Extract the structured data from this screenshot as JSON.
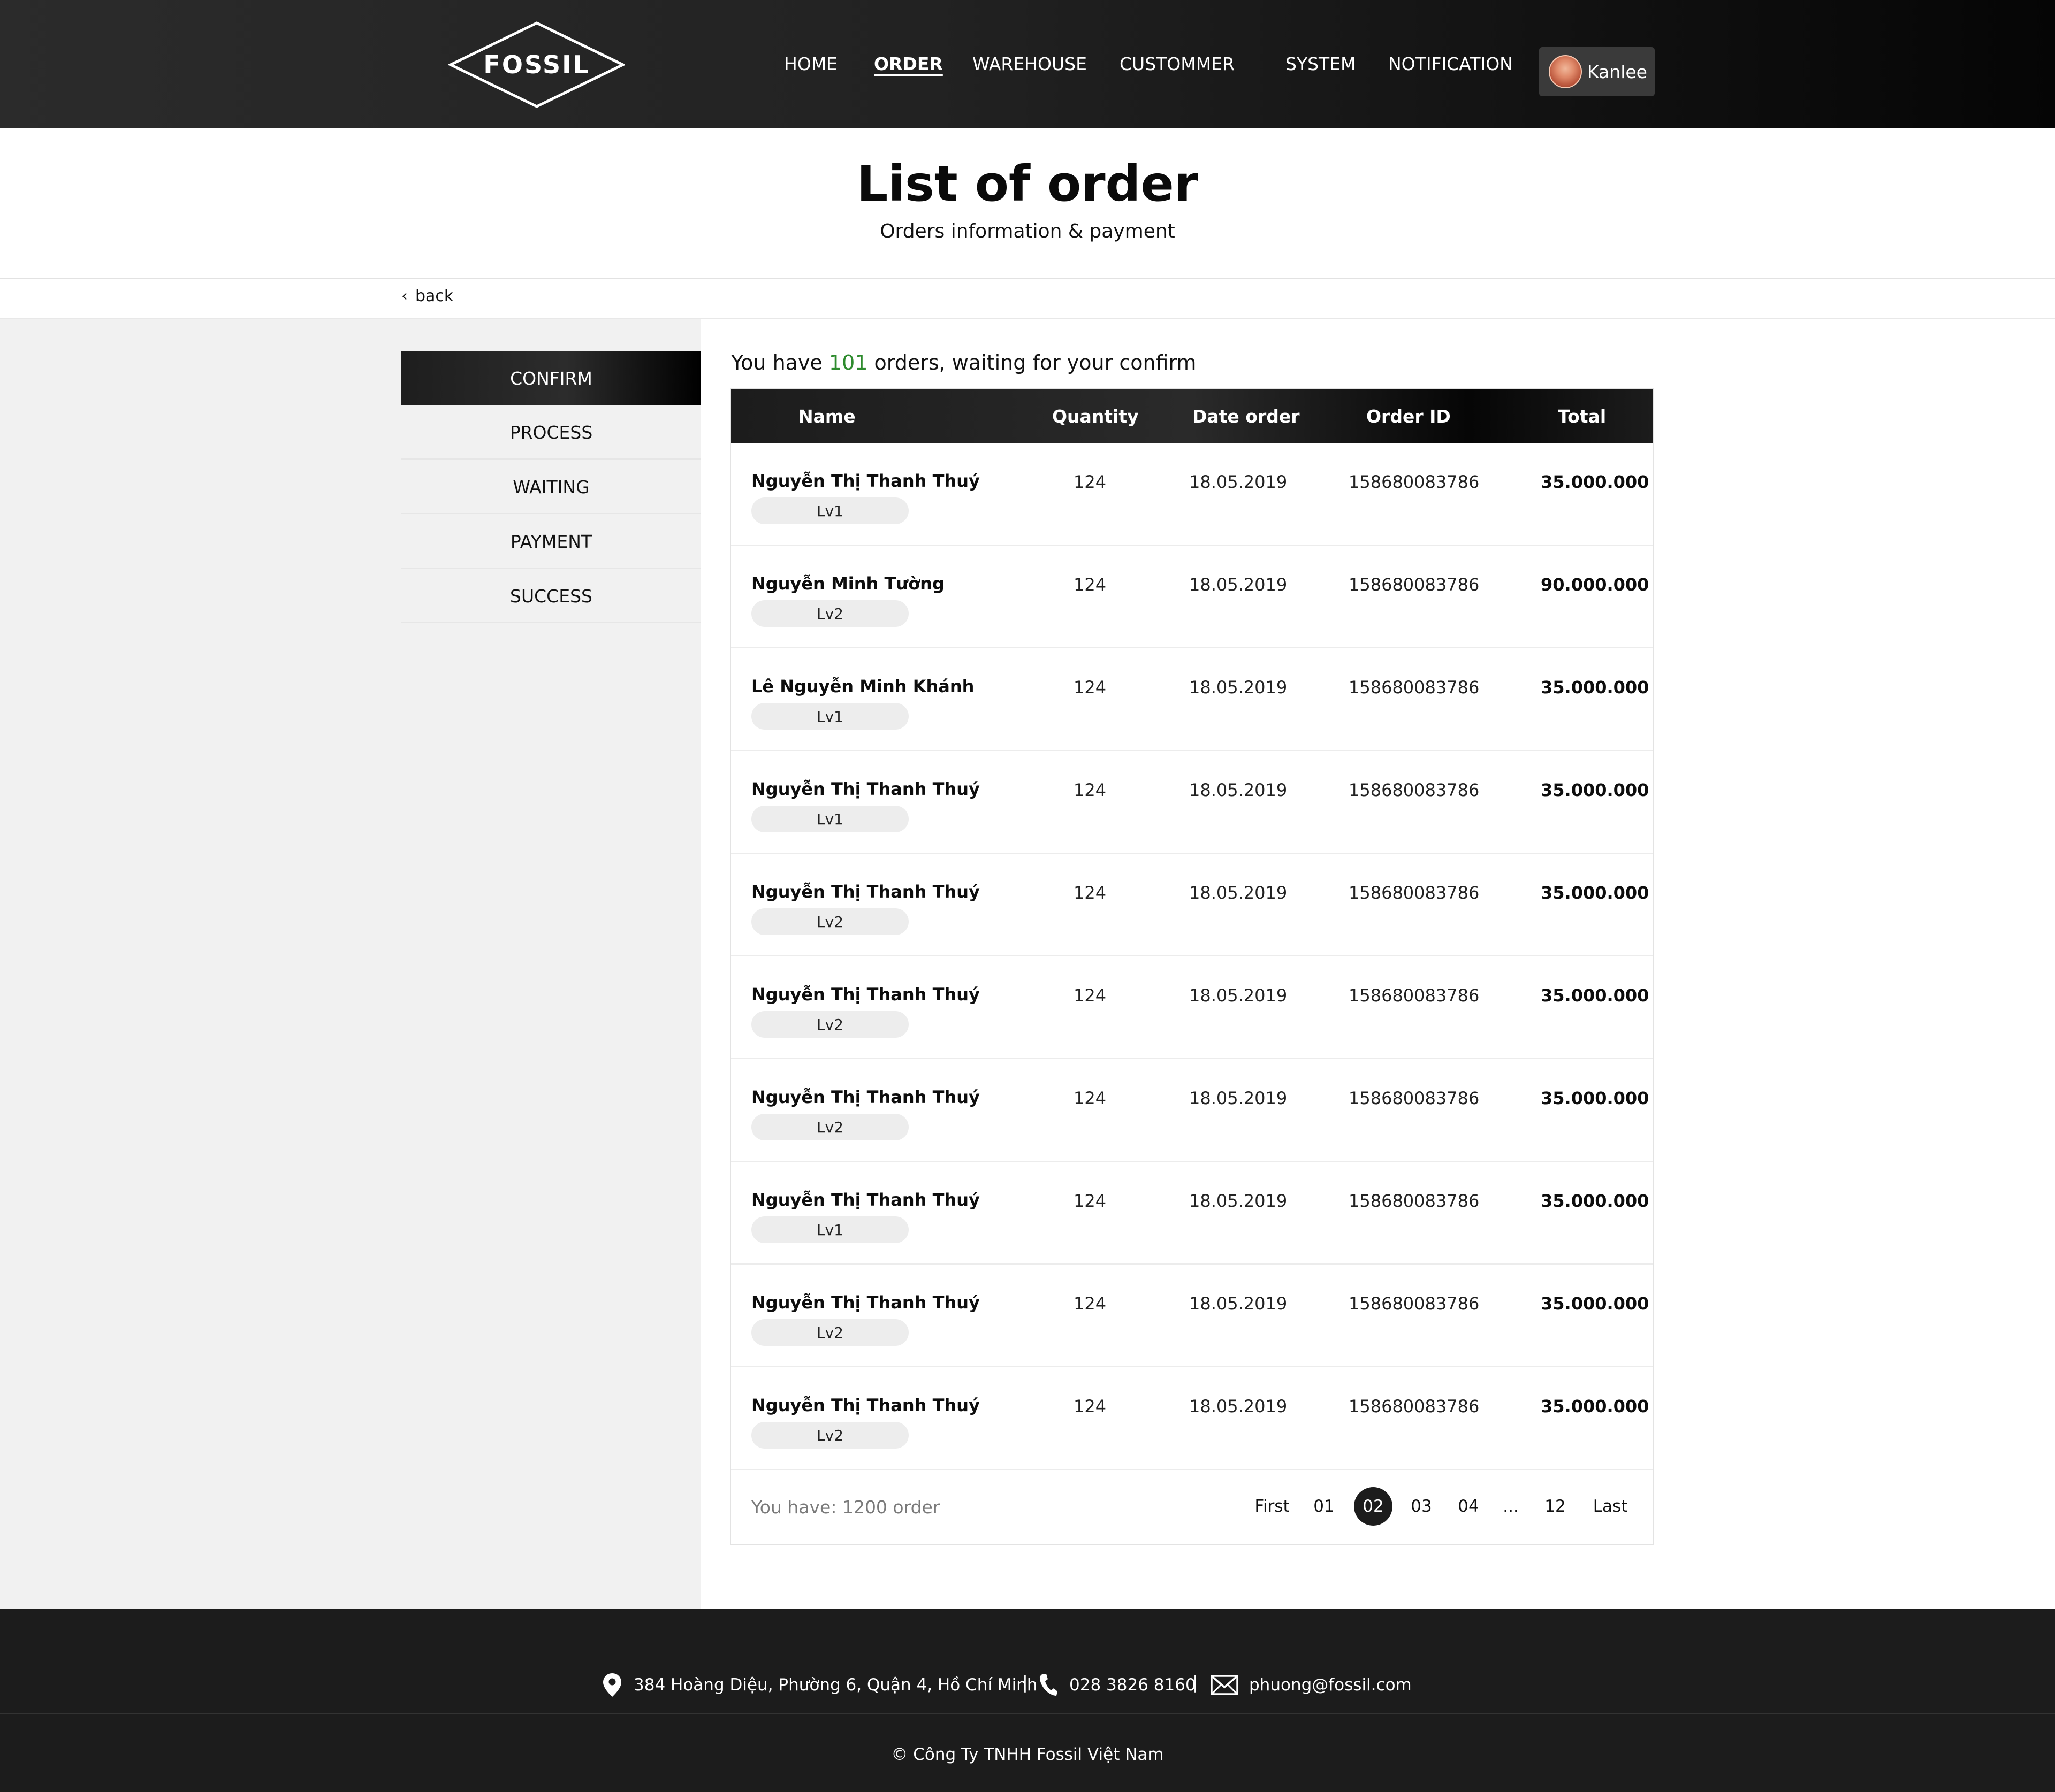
{
  "brand": {
    "logo_text": "FOSSIL"
  },
  "nav": {
    "items": [
      {
        "label": "HOME"
      },
      {
        "label": "ORDER",
        "active": true
      },
      {
        "label": "WAREHOUSE"
      },
      {
        "label": "CUSTOMMER"
      },
      {
        "label": "SYSTEM"
      },
      {
        "label": "NOTIFICATION"
      }
    ],
    "user": {
      "name": "Kanlee"
    }
  },
  "page": {
    "title": "List of order",
    "subtitle": "Orders information & payment",
    "back_label": "back"
  },
  "sidebar": {
    "items": [
      {
        "label": "CONFIRM",
        "active": true
      },
      {
        "label": "PROCESS"
      },
      {
        "label": "WAITING"
      },
      {
        "label": "PAYMENT"
      },
      {
        "label": "SUCCESS"
      }
    ]
  },
  "summary": {
    "prefix": "You have ",
    "count": "101",
    "suffix": " orders, waiting for your confirm"
  },
  "table": {
    "headers": {
      "name": "Name",
      "quantity": "Quantity",
      "date": "Date order",
      "order_id": "Order ID",
      "total": "Total"
    },
    "rows": [
      {
        "name": "Nguyễn Thị Thanh Thuý",
        "level": "Lv1",
        "quantity": "124",
        "date": "18.05.2019",
        "order_id": "158680083786",
        "total": "35.000.000"
      },
      {
        "name": "Nguyễn Minh Tường",
        "level": "Lv2",
        "quantity": "124",
        "date": "18.05.2019",
        "order_id": "158680083786",
        "total": "90.000.000"
      },
      {
        "name": "Lê Nguyễn Minh Khánh",
        "level": "Lv1",
        "quantity": "124",
        "date": "18.05.2019",
        "order_id": "158680083786",
        "total": "35.000.000"
      },
      {
        "name": "Nguyễn Thị Thanh Thuý",
        "level": "Lv1",
        "quantity": "124",
        "date": "18.05.2019",
        "order_id": "158680083786",
        "total": "35.000.000"
      },
      {
        "name": "Nguyễn Thị Thanh Thuý",
        "level": "Lv2",
        "quantity": "124",
        "date": "18.05.2019",
        "order_id": "158680083786",
        "total": "35.000.000"
      },
      {
        "name": "Nguyễn Thị Thanh Thuý",
        "level": "Lv2",
        "quantity": "124",
        "date": "18.05.2019",
        "order_id": "158680083786",
        "total": "35.000.000"
      },
      {
        "name": "Nguyễn Thị Thanh Thuý",
        "level": "Lv2",
        "quantity": "124",
        "date": "18.05.2019",
        "order_id": "158680083786",
        "total": "35.000.000"
      },
      {
        "name": "Nguyễn Thị Thanh Thuý",
        "level": "Lv1",
        "quantity": "124",
        "date": "18.05.2019",
        "order_id": "158680083786",
        "total": "35.000.000"
      },
      {
        "name": "Nguyễn Thị Thanh Thuý",
        "level": "Lv2",
        "quantity": "124",
        "date": "18.05.2019",
        "order_id": "158680083786",
        "total": "35.000.000"
      },
      {
        "name": "Nguyễn Thị Thanh Thuý",
        "level": "Lv2",
        "quantity": "124",
        "date": "18.05.2019",
        "order_id": "158680083786",
        "total": "35.000.000"
      }
    ],
    "footer_info": "You have: 1200 order"
  },
  "pagination": {
    "first": "First",
    "pages": [
      "01",
      "02",
      "03",
      "04"
    ],
    "current": "02",
    "ellipsis": "...",
    "last_page": "12",
    "last": "Last"
  },
  "footer": {
    "address": "384 Hoàng Diệu, Phường 6, Quận 4, Hồ Chí Minh",
    "phone": "028 3826 8160",
    "email": "phuong@fossil.com",
    "separator": "|",
    "copyright": "© Công Ty TNHH Fossil Việt Nam"
  },
  "colors": {
    "accent_count": "#2e8b2e",
    "header_dark": "#1c1c1c",
    "sidebar_bg": "#f1f1f1"
  }
}
